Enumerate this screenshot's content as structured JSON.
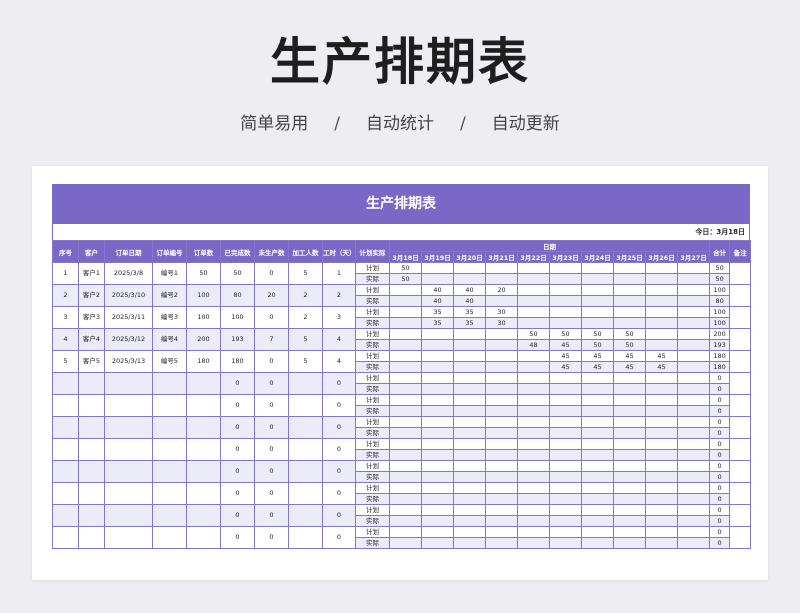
{
  "page": {
    "title": "生产排期表",
    "features": [
      "简单易用",
      "自动统计",
      "自动更新"
    ],
    "separator": "/"
  },
  "sheet": {
    "title": "生产排期表",
    "today_label": "今日：",
    "today_value": "3月18日",
    "headers": {
      "seq": "序号",
      "customer": "客户",
      "order_date": "订单日期",
      "order_no": "订单编号",
      "order_qty": "订单数",
      "completed": "已完成数",
      "remaining": "未生产数",
      "workers": "加工人数",
      "days": "工时（天）",
      "kind": "计划实际",
      "dates": "日期",
      "total": "合计",
      "note": "备注"
    },
    "day_labels": [
      "3月18日",
      "3月19日",
      "3月20日",
      "3月21日",
      "3月22日",
      "3月23日",
      "3月24日",
      "3月25日",
      "3月26日",
      "3月27日"
    ],
    "plan_label": "计划",
    "actual_label": "实际",
    "rows": [
      {
        "seq": "1",
        "customer": "客户1",
        "order_date": "2025/3/8",
        "order_no": "编号1",
        "order_qty": "50",
        "completed": "50",
        "remaining": "0",
        "workers": "5",
        "days": "1",
        "plan": [
          "50",
          "",
          "",
          "",
          "",
          "",
          "",
          "",
          "",
          ""
        ],
        "plan_total": "50",
        "actual": [
          "50",
          "",
          "",
          "",
          "",
          "",
          "",
          "",
          "",
          ""
        ],
        "actual_total": "50"
      },
      {
        "seq": "2",
        "customer": "客户2",
        "order_date": "2025/3/10",
        "order_no": "编号2",
        "order_qty": "100",
        "completed": "80",
        "remaining": "20",
        "workers": "2",
        "days": "2",
        "plan": [
          "",
          "40",
          "40",
          "20",
          "",
          "",
          "",
          "",
          "",
          ""
        ],
        "plan_total": "100",
        "actual": [
          "",
          "40",
          "40",
          "",
          "",
          "",
          "",
          "",
          "",
          ""
        ],
        "actual_total": "80"
      },
      {
        "seq": "3",
        "customer": "客户3",
        "order_date": "2025/3/11",
        "order_no": "编号3",
        "order_qty": "100",
        "completed": "100",
        "remaining": "0",
        "workers": "2",
        "days": "3",
        "plan": [
          "",
          "35",
          "35",
          "30",
          "",
          "",
          "",
          "",
          "",
          ""
        ],
        "plan_total": "100",
        "actual": [
          "",
          "35",
          "35",
          "30",
          "",
          "",
          "",
          "",
          "",
          ""
        ],
        "actual_total": "100"
      },
      {
        "seq": "4",
        "customer": "客户4",
        "order_date": "2025/3/12",
        "order_no": "编号4",
        "order_qty": "200",
        "completed": "193",
        "remaining": "7",
        "workers": "5",
        "days": "4",
        "plan": [
          "",
          "",
          "",
          "",
          "50",
          "50",
          "50",
          "50",
          "",
          ""
        ],
        "plan_total": "200",
        "actual": [
          "",
          "",
          "",
          "",
          "48",
          "45",
          "50",
          "50",
          "",
          ""
        ],
        "actual_total": "193"
      },
      {
        "seq": "5",
        "customer": "客户5",
        "order_date": "2025/3/13",
        "order_no": "编号5",
        "order_qty": "180",
        "completed": "180",
        "remaining": "0",
        "workers": "5",
        "days": "4",
        "plan": [
          "",
          "",
          "",
          "",
          "",
          "45",
          "45",
          "45",
          "45",
          ""
        ],
        "plan_total": "180",
        "actual": [
          "",
          "",
          "",
          "",
          "",
          "45",
          "45",
          "45",
          "45",
          ""
        ],
        "actual_total": "180"
      },
      {
        "seq": "",
        "customer": "",
        "order_date": "",
        "order_no": "",
        "order_qty": "",
        "completed": "0",
        "remaining": "0",
        "workers": "",
        "days": "0",
        "plan": [
          "",
          "",
          "",
          "",
          "",
          "",
          "",
          "",
          "",
          ""
        ],
        "plan_total": "0",
        "actual": [
          "",
          "",
          "",
          "",
          "",
          "",
          "",
          "",
          "",
          ""
        ],
        "actual_total": "0"
      },
      {
        "seq": "",
        "customer": "",
        "order_date": "",
        "order_no": "",
        "order_qty": "",
        "completed": "0",
        "remaining": "0",
        "workers": "",
        "days": "0",
        "plan": [
          "",
          "",
          "",
          "",
          "",
          "",
          "",
          "",
          "",
          ""
        ],
        "plan_total": "0",
        "actual": [
          "",
          "",
          "",
          "",
          "",
          "",
          "",
          "",
          "",
          ""
        ],
        "actual_total": "0"
      },
      {
        "seq": "",
        "customer": "",
        "order_date": "",
        "order_no": "",
        "order_qty": "",
        "completed": "0",
        "remaining": "0",
        "workers": "",
        "days": "0",
        "plan": [
          "",
          "",
          "",
          "",
          "",
          "",
          "",
          "",
          "",
          ""
        ],
        "plan_total": "0",
        "actual": [
          "",
          "",
          "",
          "",
          "",
          "",
          "",
          "",
          "",
          ""
        ],
        "actual_total": "0"
      },
      {
        "seq": "",
        "customer": "",
        "order_date": "",
        "order_no": "",
        "order_qty": "",
        "completed": "0",
        "remaining": "0",
        "workers": "",
        "days": "0",
        "plan": [
          "",
          "",
          "",
          "",
          "",
          "",
          "",
          "",
          "",
          ""
        ],
        "plan_total": "0",
        "actual": [
          "",
          "",
          "",
          "",
          "",
          "",
          "",
          "",
          "",
          ""
        ],
        "actual_total": "0"
      },
      {
        "seq": "",
        "customer": "",
        "order_date": "",
        "order_no": "",
        "order_qty": "",
        "completed": "0",
        "remaining": "0",
        "workers": "",
        "days": "0",
        "plan": [
          "",
          "",
          "",
          "",
          "",
          "",
          "",
          "",
          "",
          ""
        ],
        "plan_total": "0",
        "actual": [
          "",
          "",
          "",
          "",
          "",
          "",
          "",
          "",
          "",
          ""
        ],
        "actual_total": "0"
      },
      {
        "seq": "",
        "customer": "",
        "order_date": "",
        "order_no": "",
        "order_qty": "",
        "completed": "0",
        "remaining": "0",
        "workers": "",
        "days": "0",
        "plan": [
          "",
          "",
          "",
          "",
          "",
          "",
          "",
          "",
          "",
          ""
        ],
        "plan_total": "0",
        "actual": [
          "",
          "",
          "",
          "",
          "",
          "",
          "",
          "",
          "",
          ""
        ],
        "actual_total": "0"
      },
      {
        "seq": "",
        "customer": "",
        "order_date": "",
        "order_no": "",
        "order_qty": "",
        "completed": "0",
        "remaining": "0",
        "workers": "",
        "days": "0",
        "plan": [
          "",
          "",
          "",
          "",
          "",
          "",
          "",
          "",
          "",
          ""
        ],
        "plan_total": "0",
        "actual": [
          "",
          "",
          "",
          "",
          "",
          "",
          "",
          "",
          "",
          ""
        ],
        "actual_total": "0"
      },
      {
        "seq": "",
        "customer": "",
        "order_date": "",
        "order_no": "",
        "order_qty": "",
        "completed": "0",
        "remaining": "0",
        "workers": "",
        "days": "0",
        "plan": [
          "",
          "",
          "",
          "",
          "",
          "",
          "",
          "",
          "",
          ""
        ],
        "plan_total": "0",
        "actual": [
          "",
          "",
          "",
          "",
          "",
          "",
          "",
          "",
          "",
          ""
        ],
        "actual_total": "0"
      }
    ]
  }
}
